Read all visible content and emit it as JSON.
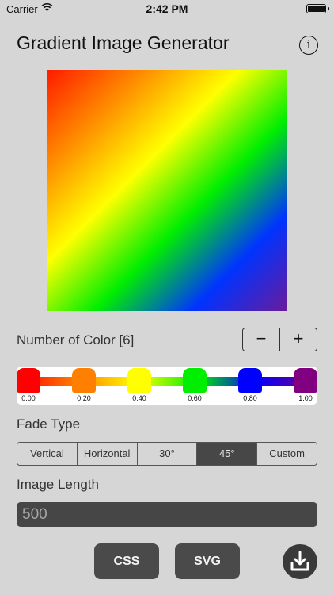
{
  "status_bar": {
    "carrier": "Carrier",
    "time": "2:42 PM"
  },
  "header": {
    "title": "Gradient Image Generator",
    "info_icon": "i"
  },
  "preview": {
    "angle_deg": 45,
    "colors": [
      "#ff1a00",
      "#ff8a00",
      "#ffff00",
      "#00ee00",
      "#0033ff",
      "#6a1b9a"
    ]
  },
  "colors_section": {
    "label": "Number of Color [6]",
    "decrement": "−",
    "increment": "+",
    "stops": [
      {
        "value": "0.00",
        "position": 0.0,
        "color": "#ff0000"
      },
      {
        "value": "0.20",
        "position": 0.2,
        "color": "#ff8000"
      },
      {
        "value": "0.40",
        "position": 0.4,
        "color": "#ffff00"
      },
      {
        "value": "0.60",
        "position": 0.6,
        "color": "#00ee00"
      },
      {
        "value": "0.80",
        "position": 0.8,
        "color": "#0000ff"
      },
      {
        "value": "1.00",
        "position": 1.0,
        "color": "#800080"
      }
    ]
  },
  "fade_type": {
    "label": "Fade Type",
    "options": [
      "Vertical",
      "Horizontal",
      "30°",
      "45°",
      "Custom"
    ],
    "selected": "45°"
  },
  "image_length": {
    "label": "Image Length",
    "value": "500"
  },
  "actions": {
    "css": "CSS",
    "svg": "SVG",
    "download_icon": "download-icon"
  }
}
